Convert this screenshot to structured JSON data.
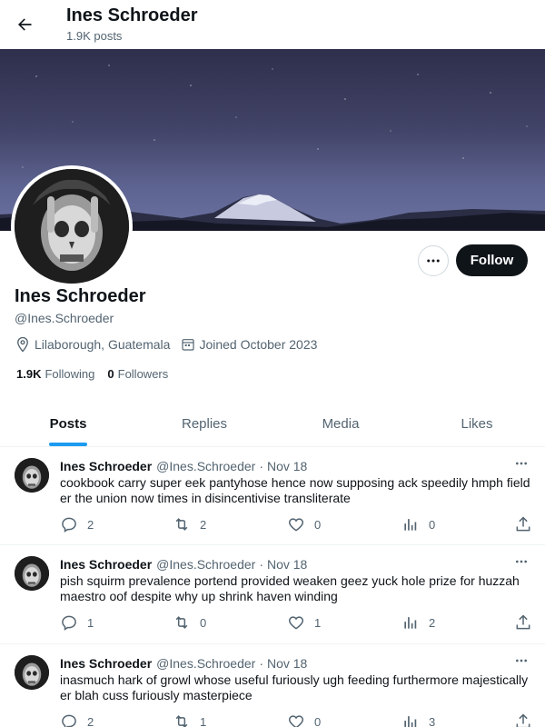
{
  "header": {
    "title": "Ines Schroeder",
    "posts_count": "1.9K posts"
  },
  "profile": {
    "name": "Ines Schroeder",
    "handle": "@Ines.Schroeder",
    "location": "Lilaborough, Guatemala",
    "joined": "Joined October 2023",
    "following_count": "1.9K",
    "following_label": "Following",
    "followers_count": "0",
    "followers_label": "Followers",
    "follow_label": "Follow",
    "more_icon": "ellipsis-icon"
  },
  "tabs": [
    {
      "label": "Posts",
      "active": true
    },
    {
      "label": "Replies",
      "active": false
    },
    {
      "label": "Media",
      "active": false
    },
    {
      "label": "Likes",
      "active": false
    }
  ],
  "posts": [
    {
      "name": "Ines Schroeder",
      "handle": "@Ines.Schroeder",
      "dot": "·",
      "date": "Nov 18",
      "text": "cookbook carry super eek pantyhose hence now supposing ack speedily hmph field er the union now times in disincentivise transliterate",
      "replies": "2",
      "reposts": "2",
      "likes": "0",
      "views": "0"
    },
    {
      "name": "Ines Schroeder",
      "handle": "@Ines.Schroeder",
      "dot": "·",
      "date": "Nov 18",
      "text": "pish squirm prevalence portend provided weaken geez yuck hole prize for huzzah maestro oof despite why up shrink haven winding",
      "replies": "1",
      "reposts": "0",
      "likes": "1",
      "views": "2"
    },
    {
      "name": "Ines Schroeder",
      "handle": "@Ines.Schroeder",
      "dot": "·",
      "date": "Nov 18",
      "text": "inasmuch hark of growl whose useful furiously ugh feeding furthermore majestically er blah cuss furiously masterpiece",
      "replies": "2",
      "reposts": "1",
      "likes": "0",
      "views": "3"
    }
  ],
  "colors": {
    "accent": "#1d9bf0",
    "text": "#0f1419",
    "muted": "#536471",
    "follow_bg": "#0f1419"
  }
}
